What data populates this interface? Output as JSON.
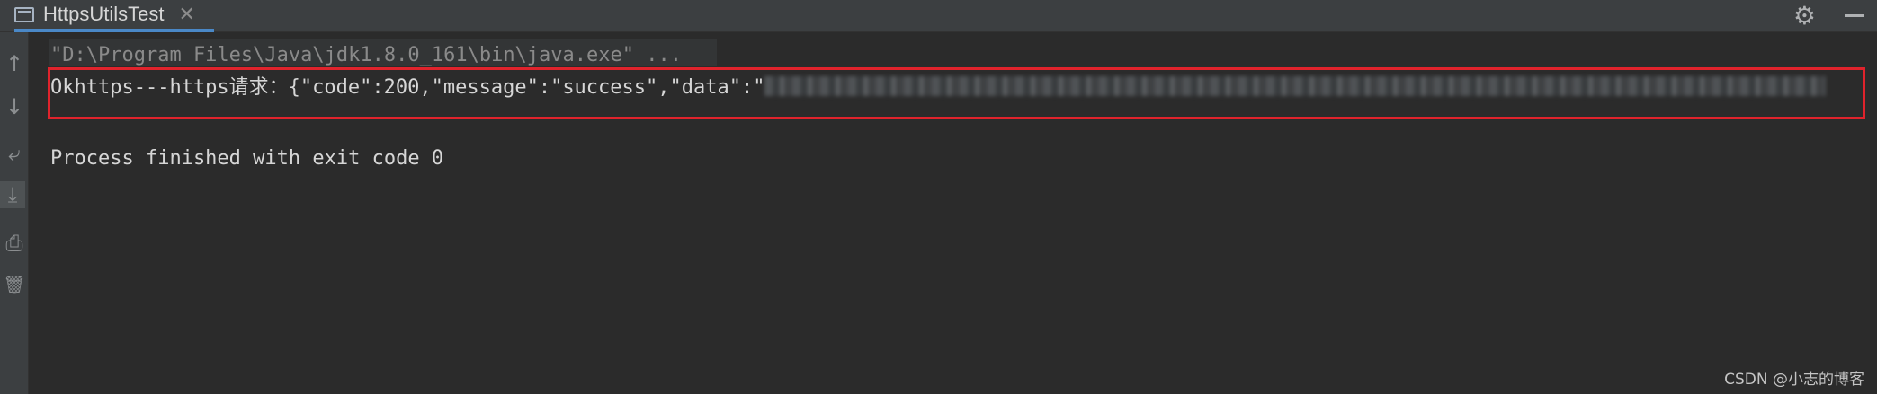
{
  "tab": {
    "title": "HttpsUtilsTest",
    "close": "✕"
  },
  "toolbar": {
    "settings_icon": "gear-icon",
    "minimize_icon": "minimize-icon"
  },
  "sidebar": {
    "items": [
      {
        "name": "arrow-up-icon",
        "glyph": "↑"
      },
      {
        "name": "arrow-down-icon",
        "glyph": "↓"
      },
      {
        "name": "soft-wrap-icon",
        "glyph": "⤶"
      },
      {
        "name": "scroll-to-end-icon",
        "glyph": "⤓"
      },
      {
        "name": "print-icon",
        "glyph": "⎙"
      },
      {
        "name": "trash-icon",
        "glyph": "🗑"
      }
    ]
  },
  "console": {
    "command_line": "\"D:\\Program Files\\Java\\jdk1.8.0_161\\bin\\java.exe\" ...",
    "response_prefix": "Okhttps---https请求：{\"code\":200,\"message\":\"success\",\"data\":\"",
    "exit_line": "Process finished with exit code 0"
  },
  "colors": {
    "highlight_border": "#e0232c",
    "background": "#2b2b2b",
    "tab_underline": "#4a88c7"
  },
  "watermark": "CSDN @小志的博客"
}
